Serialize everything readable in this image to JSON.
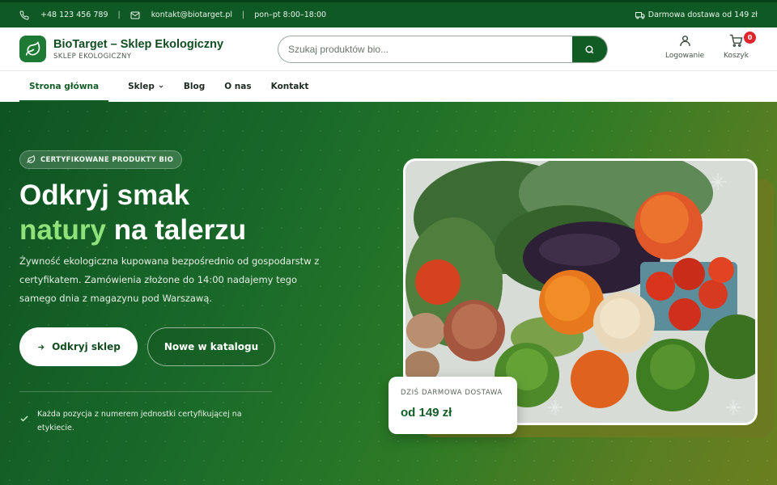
{
  "topbar": {
    "phone": "+48 123 456 789",
    "email": "kontakt@biotarget.pl",
    "hours": "pon–pt 8:00–18:00",
    "separator": "|",
    "shipping": "Darmowa dostawa od 149 zł"
  },
  "header": {
    "brand_name": "BioTarget – Sklep Ekologiczny",
    "brand_sub": "SKLEP EKOLOGICZNY",
    "search_placeholder": "Szukaj produktów bio...",
    "login_label": "Logowanie",
    "cart_label": "Koszyk",
    "cart_count": "0"
  },
  "nav": {
    "items": [
      {
        "label": "Strona główna",
        "active": true
      },
      {
        "label": "Sklep",
        "dropdown": true
      },
      {
        "label": "Blog"
      },
      {
        "label": "O nas"
      },
      {
        "label": "Kontakt"
      }
    ]
  },
  "hero": {
    "badge": "CERTYFIKOWANE PRODUKTY BIO",
    "title_line1": "Odkryj smak",
    "title_accent": "natury",
    "title_line2_rest": " na talerzu",
    "lead": "Żywność ekologiczna kupowana bezpośrednio od gospodarstw z certyfikatem. Zamówienia złożone do 14:00 nadajemy tego samego dnia z magazynu pod Warszawą.",
    "primary_button": "Odkryj sklep",
    "secondary_button": "Nowe w katalogu",
    "note": "Każda pozycja z numerem jednostki certyfikującej na etykiecie.",
    "promo_label": "DZIŚ DARMOWA DOSTAWA",
    "promo_value": "od 149 zł"
  },
  "colors": {
    "brand_green": "#155d27",
    "topbar_green": "#0f5a24",
    "accent_light_green": "#8fe27a",
    "cart_badge_red": "#e0262d"
  },
  "icons": [
    "phone-icon",
    "mail-icon",
    "truck-icon",
    "leaf-icon",
    "search-icon",
    "user-icon",
    "cart-icon",
    "chevron-down-icon",
    "arrow-right-icon",
    "check-icon"
  ]
}
